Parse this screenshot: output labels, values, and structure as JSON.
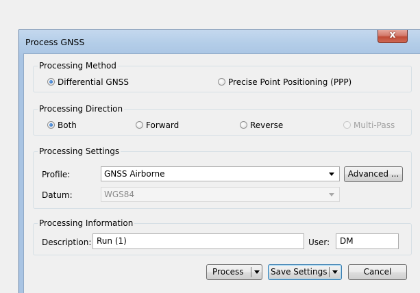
{
  "window": {
    "title": "Process GNSS",
    "close_glyph": "x"
  },
  "processing_method": {
    "legend": "Processing Method",
    "options": [
      {
        "label": "Differential GNSS",
        "selected": true
      },
      {
        "label": "Precise Point Positioning (PPP)",
        "selected": false
      }
    ]
  },
  "processing_direction": {
    "legend": "Processing Direction",
    "options": [
      {
        "label": "Both",
        "selected": true,
        "enabled": true
      },
      {
        "label": "Forward",
        "selected": false,
        "enabled": true
      },
      {
        "label": "Reverse",
        "selected": false,
        "enabled": true
      },
      {
        "label": "Multi-Pass",
        "selected": false,
        "enabled": false
      }
    ]
  },
  "processing_settings": {
    "legend": "Processing Settings",
    "profile_label": "Profile:",
    "profile_value": "GNSS Airborne",
    "advanced_label": "Advanced ...",
    "datum_label": "Datum:",
    "datum_value": "WGS84"
  },
  "processing_information": {
    "legend": "Processing Information",
    "description_label": "Description:",
    "description_value": "Run (1)",
    "user_label": "User:",
    "user_value": "DM"
  },
  "buttons": {
    "process_label": "Process",
    "save_settings_label": "Save Settings",
    "cancel_label": "Cancel"
  },
  "colors": {
    "title_bar": "#b3cde8",
    "close_button": "#c04b37",
    "radio_selected": "#1c5fb8",
    "dialog_background": "#f0f0f0"
  }
}
